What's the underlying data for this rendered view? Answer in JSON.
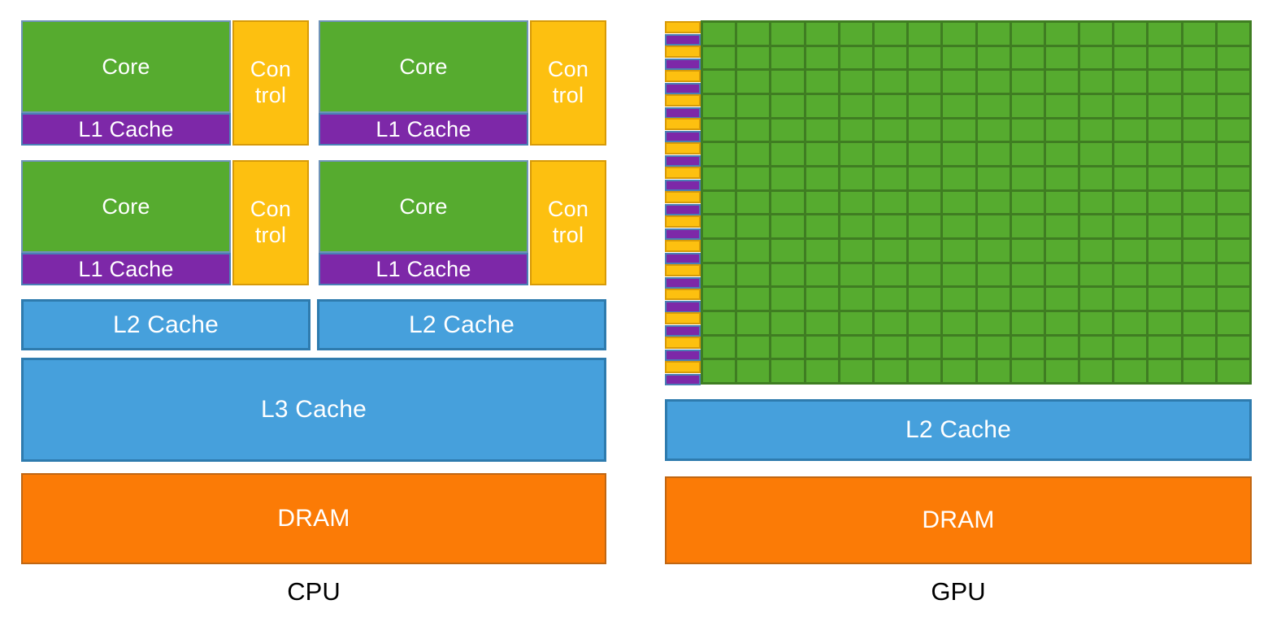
{
  "diagram": {
    "title_cpu": "CPU",
    "title_gpu": "GPU",
    "colors": {
      "core_green": "#56ab2f",
      "control_yellow": "#fdc010",
      "l1_purple": "#7d28a8",
      "cache_blue": "#46a0dc",
      "dram_orange": "#fb7b06",
      "grid_line": "#3f7d22",
      "text_light": "#ffffff",
      "text_dark": "#000000",
      "background": "#ffffff"
    }
  },
  "cpu": {
    "caption": "CPU",
    "cores": [
      {
        "core_label": "Core",
        "control_line1": "Con",
        "control_line2": "trol",
        "l1_label": "L1 Cache"
      },
      {
        "core_label": "Core",
        "control_line1": "Con",
        "control_line2": "trol",
        "l1_label": "L1 Cache"
      },
      {
        "core_label": "Core",
        "control_line1": "Con",
        "control_line2": "trol",
        "l1_label": "L1 Cache"
      },
      {
        "core_label": "Core",
        "control_line1": "Con",
        "control_line2": "trol",
        "l1_label": "L1 Cache"
      }
    ],
    "l2_caches": [
      {
        "label": "L2 Cache"
      },
      {
        "label": "L2 Cache"
      }
    ],
    "l3_cache": {
      "label": "L3  Cache"
    },
    "dram": {
      "label": "DRAM"
    }
  },
  "gpu": {
    "caption": "GPU",
    "sm_rows": 15,
    "core_grid": {
      "columns": 16,
      "rows": 15,
      "total_cells": 240
    },
    "l2_cache": {
      "label": "L2 Cache"
    },
    "dram": {
      "label": "DRAM"
    }
  }
}
